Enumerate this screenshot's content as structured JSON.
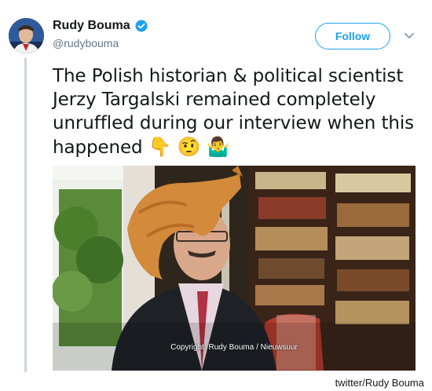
{
  "user": {
    "display_name": "Rudy Bouma",
    "handle": "@rudybouma",
    "verified": true
  },
  "follow_label": "Follow",
  "tweet": {
    "text": "The Polish historian & political scientist Jerzy Targalski remained completely unruffled during our interview when this happened",
    "emojis": [
      "👇",
      "🤨",
      "🤷‍♂️"
    ]
  },
  "media": {
    "caption": "Copyright: Rudy Bouma / Nieuwsuur"
  },
  "credit": "twitter/Rudy Bouma",
  "colors": {
    "accent": "#1da1f2",
    "secondary_text": "#657786",
    "thread_line": "#ccd6dd"
  },
  "icons": [
    "verified-badge-icon",
    "chevron-down-icon"
  ]
}
